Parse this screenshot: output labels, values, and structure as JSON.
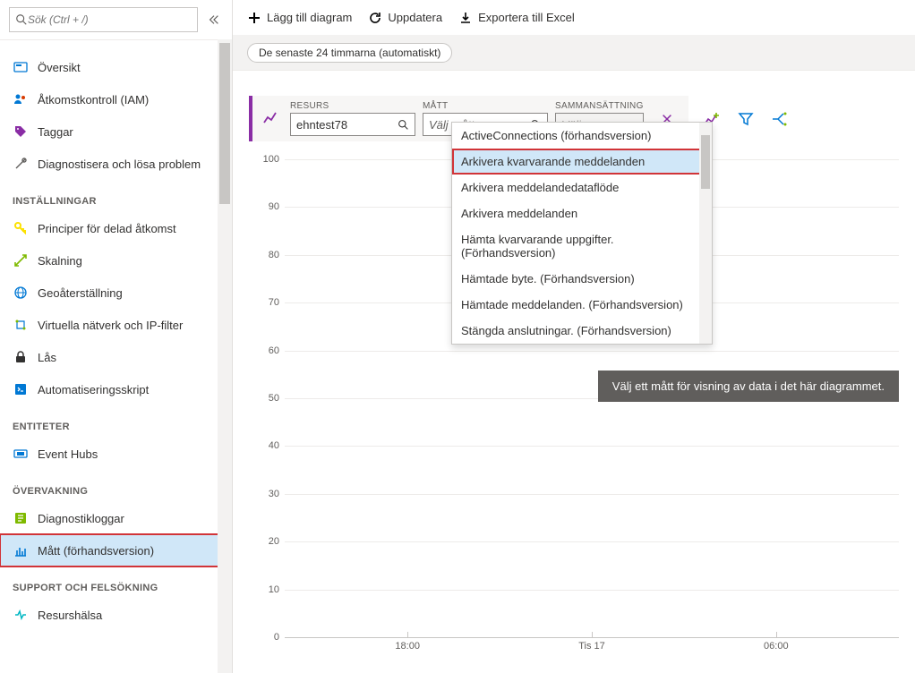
{
  "search": {
    "placeholder": "Sök (Ctrl + /)"
  },
  "sidebar": {
    "top": [
      {
        "label": "Översikt",
        "icon": "overview"
      },
      {
        "label": "Åtkomstkontroll (IAM)",
        "icon": "people"
      },
      {
        "label": "Taggar",
        "icon": "tag"
      },
      {
        "label": "Diagnostisera och lösa problem",
        "icon": "tools"
      }
    ],
    "settings_header": "INSTÄLLNINGAR",
    "settings": [
      {
        "label": "Principer för delad åtkomst",
        "icon": "key"
      },
      {
        "label": "Skalning",
        "icon": "scale"
      },
      {
        "label": "Geoåterställning",
        "icon": "globe"
      },
      {
        "label": "Virtuella nätverk och IP-filter",
        "icon": "vnet"
      },
      {
        "label": "Lås",
        "icon": "lock"
      },
      {
        "label": "Automatiseringsskript",
        "icon": "script"
      }
    ],
    "entities_header": "ENTITETER",
    "entities": [
      {
        "label": "Event Hubs",
        "icon": "eventhub"
      }
    ],
    "monitoring_header": "ÖVERVAKNING",
    "monitoring": [
      {
        "label": "Diagnostikloggar",
        "icon": "diag"
      },
      {
        "label": "Mått (förhandsversion)",
        "icon": "metrics",
        "selected": true
      }
    ],
    "support_header": "SUPPORT OCH FELSÖKNING",
    "support": [
      {
        "label": "Resurshälsa",
        "icon": "health"
      }
    ]
  },
  "toolbar": {
    "add": "Lägg till diagram",
    "refresh": "Uppdatera",
    "export": "Exportera till Excel"
  },
  "time_pill": "De senaste 24 timmarna (automatiskt)",
  "config": {
    "resource_label": "RESURS",
    "resource_value": "ehntest78",
    "metric_label": "MÅTT",
    "metric_placeholder": "Välj mått",
    "agg_label": "SAMMANSÄTTNING",
    "agg_placeholder": "Välj"
  },
  "dropdown": {
    "items": [
      "ActiveConnections (förhandsversion)",
      "Arkivera kvarvarande meddelanden",
      "Arkivera meddelandedataflöde",
      "Arkivera meddelanden",
      "Hämta kvarvarande uppgifter. (Förhandsversion)",
      "Hämtade byte. (Förhandsversion)",
      "Hämtade meddelanden. (Förhandsversion)",
      "Stängda anslutningar. (Förhandsversion)"
    ],
    "highlighted_index": 1
  },
  "overlay_message": "Välj ett mått för visning av data i det här diagrammet.",
  "chart_data": {
    "type": "line",
    "title": "",
    "xlabel": "",
    "ylabel": "",
    "ylim": [
      0,
      100
    ],
    "y_ticks": [
      0,
      10,
      20,
      30,
      40,
      50,
      60,
      70,
      80,
      90,
      100
    ],
    "x_ticks": [
      "18:00",
      "Tis 17",
      "06:00"
    ],
    "series": []
  }
}
